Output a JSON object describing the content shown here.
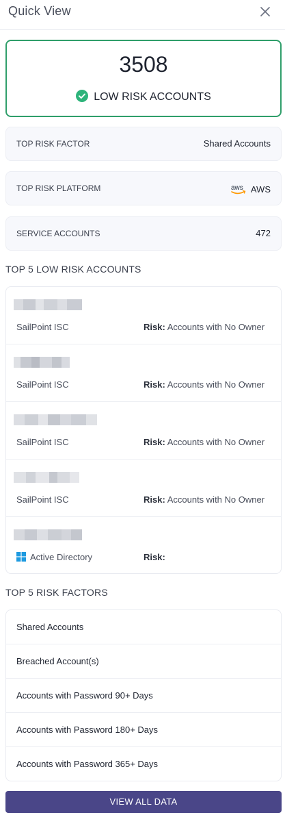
{
  "header": {
    "title": "Quick View",
    "close_icon": "close-icon"
  },
  "summary": {
    "count": "3508",
    "status_label": "LOW RISK ACCOUNTS",
    "status_icon": "check-circle-icon",
    "accent_color": "#2f9e6a"
  },
  "stats": {
    "top_risk_factor": {
      "label": "TOP RISK FACTOR",
      "value": "Shared Accounts"
    },
    "top_risk_platform": {
      "label": "TOP RISK PLATFORM",
      "value": "AWS",
      "logo": "aws-logo-icon",
      "logo_text": "aws"
    },
    "service_accounts": {
      "label": "SERVICE ACCOUNTS",
      "value": "472"
    }
  },
  "top_accounts": {
    "title": "TOP 5 LOW RISK ACCOUNTS",
    "risk_label": "Risk:",
    "items": [
      {
        "platform": "SailPoint ISC",
        "risk": "Accounts with No Owner"
      },
      {
        "platform": "SailPoint ISC",
        "risk": "Accounts with No Owner"
      },
      {
        "platform": "SailPoint ISC",
        "risk": "Accounts with No Owner"
      },
      {
        "platform": "SailPoint ISC",
        "risk": "Accounts with No Owner"
      },
      {
        "platform": "Active Directory",
        "risk": "",
        "platform_icon": "windows-icon"
      }
    ]
  },
  "risk_factors": {
    "title": "TOP 5 RISK FACTORS",
    "items": [
      "Shared Accounts",
      "Breached Account(s)",
      "Accounts with Password 90+ Days",
      "Accounts with Password 180+ Days",
      "Accounts with Password 365+ Days"
    ]
  },
  "footer": {
    "button_label": "VIEW ALL DATA",
    "button_color": "#4a4688"
  }
}
